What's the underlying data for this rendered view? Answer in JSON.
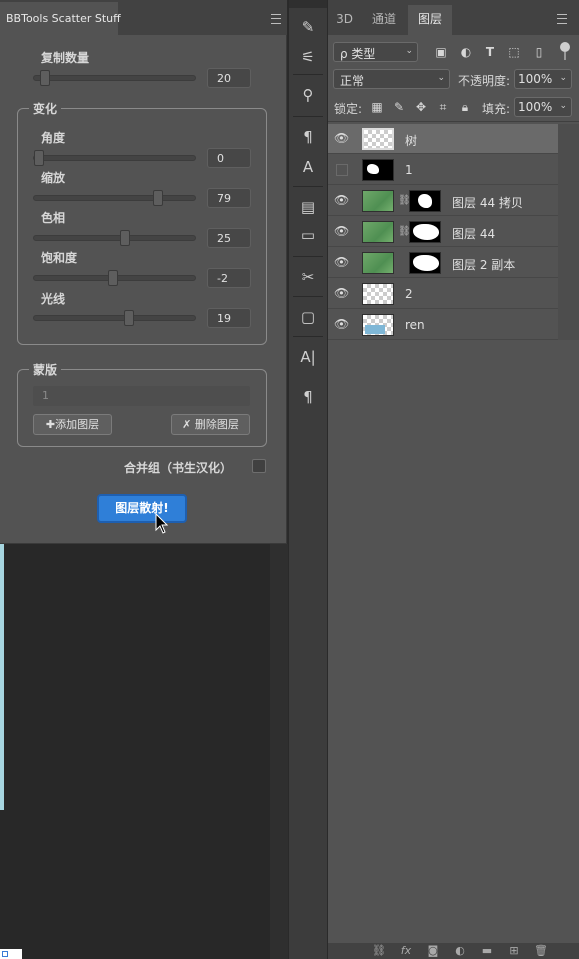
{
  "scatter_panel": {
    "title": "BBTools Scatter Stuff",
    "copy_count": {
      "label": "复制数量",
      "value": "20",
      "slider_fraction": 0.05
    },
    "transform_group": {
      "title": "变化",
      "angle": {
        "label": "角度",
        "value": "0",
        "slider_fraction": 0.0
      },
      "scale": {
        "label": "缩放",
        "value": "79",
        "slider_fraction": 0.79
      },
      "hue": {
        "label": "色相",
        "value": "25",
        "slider_fraction": 0.56
      },
      "saturation": {
        "label": "饱和度",
        "value": "-2",
        "slider_fraction": 0.49
      },
      "lightness": {
        "label": "光线",
        "value": "19",
        "slider_fraction": 0.59
      }
    },
    "mask_group": {
      "title": "蒙版",
      "field_value": "1",
      "add_layer_label": "✚添加图层",
      "delete_layer_label": "✗ 删除图层"
    },
    "merge_group_label": "合并组（书生汉化）",
    "scatter_button_label": "图层散射!"
  },
  "layers_panel": {
    "tabs": [
      "3D",
      "通道",
      "图层"
    ],
    "active_tab": "图层",
    "filter_select": "ρ 类型",
    "blend_mode": "正常",
    "opacity_label": "不透明度:",
    "opacity_value": "100%",
    "lock_label": "锁定:",
    "fill_label": "填充:",
    "fill_value": "100%",
    "layers": [
      {
        "name": "树",
        "visible": true,
        "selected": true,
        "thumb": "checker",
        "mask": false
      },
      {
        "name": "1",
        "visible": false,
        "selected": false,
        "thumb": "mask",
        "mask": false
      },
      {
        "name": "图层 44 拷贝",
        "visible": true,
        "selected": false,
        "thumb": "green",
        "mask": true
      },
      {
        "name": "图层 44",
        "visible": true,
        "selected": false,
        "thumb": "green",
        "mask": true
      },
      {
        "name": "图层 2 副本",
        "visible": true,
        "selected": false,
        "thumb": "green",
        "mask": true
      },
      {
        "name": "2",
        "visible": true,
        "selected": false,
        "thumb": "checker",
        "mask": false
      },
      {
        "name": "ren",
        "visible": true,
        "selected": false,
        "thumb": "checker",
        "mask": false
      }
    ],
    "bottom_icons": [
      "link-icon",
      "fx-icon",
      "mask-icon",
      "adjustment-icon",
      "folder-icon",
      "new-layer-icon",
      "trash-icon"
    ]
  },
  "toolstrip": {
    "tools": [
      "brush-settings-icon",
      "brush-presets-icon",
      "clone-source-icon",
      "paragraph-styles-icon",
      "character-styles-icon",
      "properties-icon",
      "notes-icon",
      "tool-presets-icon",
      "layer-comps-icon",
      "character-icon",
      "paragraph-icon"
    ]
  }
}
